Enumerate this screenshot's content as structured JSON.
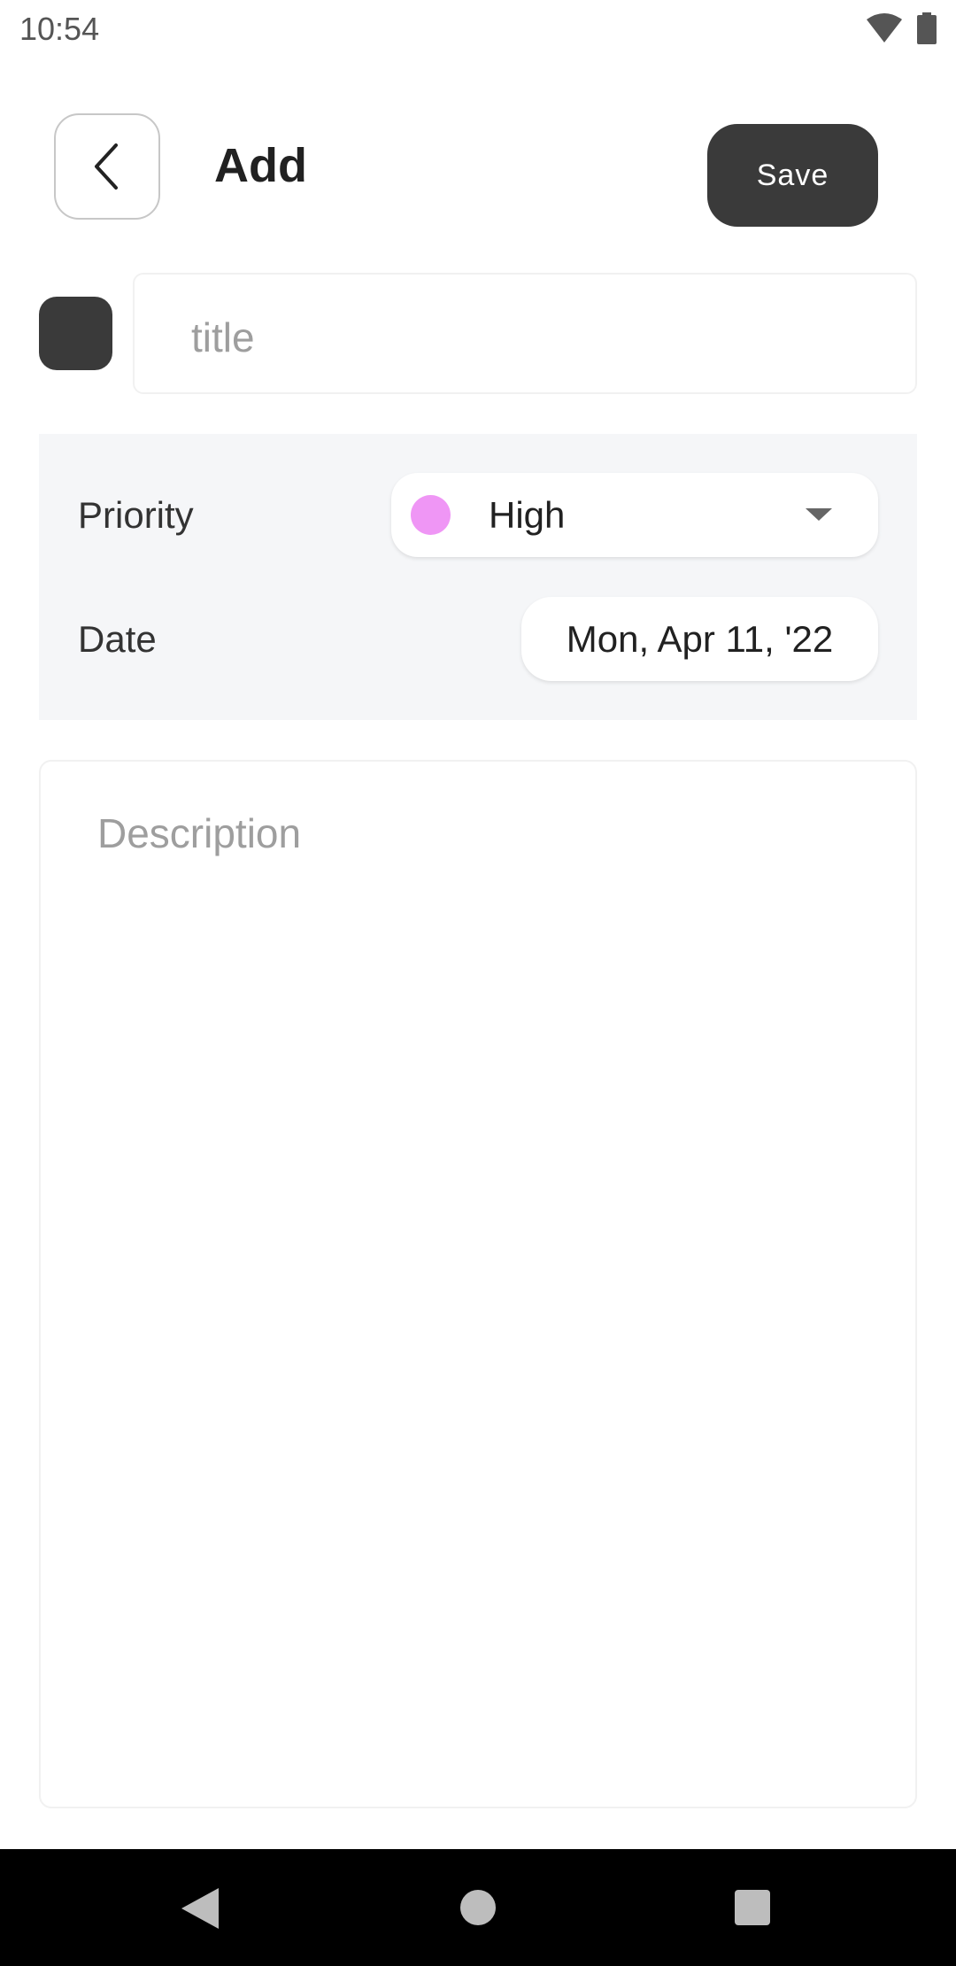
{
  "status_bar": {
    "time": "10:54",
    "icons": [
      "wifi-icon",
      "battery-icon"
    ]
  },
  "header": {
    "back_icon": "chevron-left-icon",
    "title": "Add",
    "save_label": "Save"
  },
  "title_field": {
    "placeholder": "title",
    "color_swatch": "#3a3a3a"
  },
  "priority": {
    "label": "Priority",
    "selected": "High",
    "selected_color": "#ef96f5"
  },
  "date": {
    "label": "Date",
    "value": "Mon, Apr 11, '22"
  },
  "description": {
    "placeholder": "Description"
  },
  "nav_bar": {
    "icons": [
      "nav-back-icon",
      "nav-home-icon",
      "nav-recents-icon"
    ]
  },
  "colors": {
    "accent_dark": "#3a3a3a",
    "panel_bg": "#f5f6f8",
    "placeholder": "#9e9e9e"
  }
}
